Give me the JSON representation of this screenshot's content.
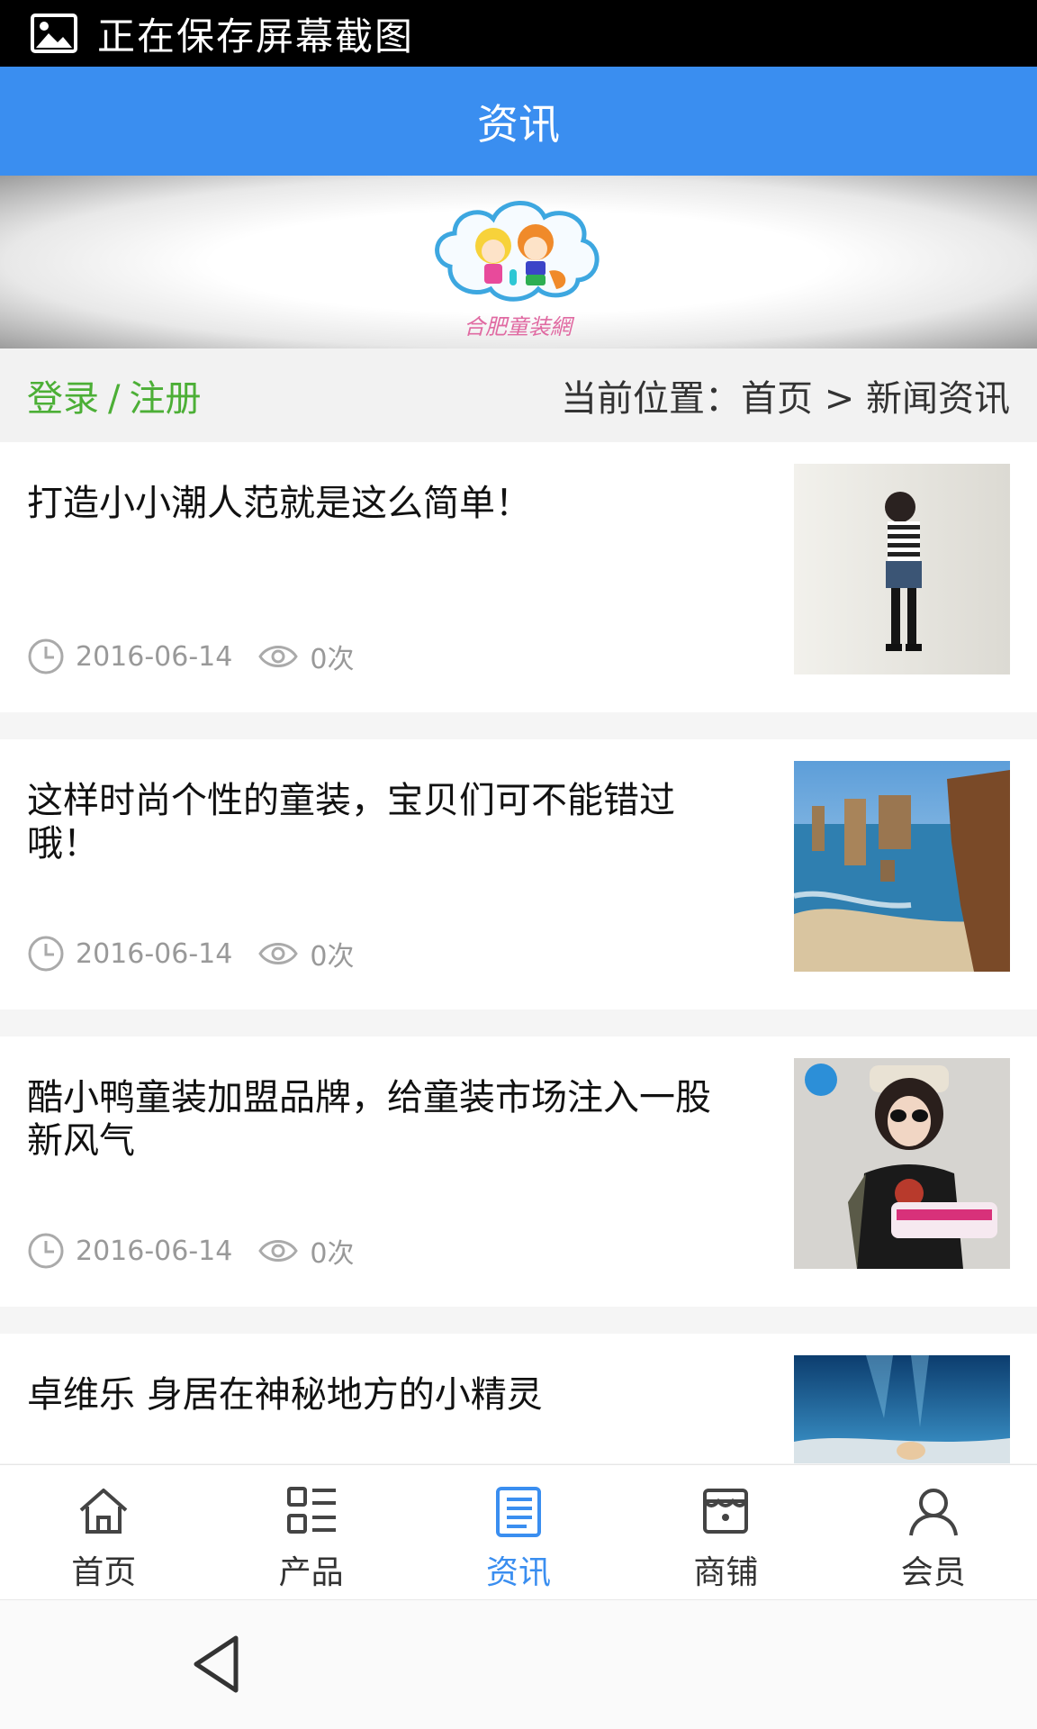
{
  "status_bar": {
    "text": "正在保存屏幕截图"
  },
  "header": {
    "title": "资讯"
  },
  "banner": {
    "logo_text": "合肥童装網"
  },
  "info_bar": {
    "login": "登录",
    "separator": "/",
    "register": "注册",
    "breadcrumb": "当前位置：首页 > 新闻资讯"
  },
  "news": [
    {
      "title": "打造小小潮人范就是这么简单！",
      "date": "2016-06-14",
      "views": "0次"
    },
    {
      "title": "这样时尚个性的童装，宝贝们可不能错过哦！",
      "date": "2016-06-14",
      "views": "0次"
    },
    {
      "title": "酷小鸭童装加盟品牌，给童装市场注入一股新风气",
      "date": "2016-06-14",
      "views": "0次"
    },
    {
      "title": "卓维乐 身居在神秘地方的小精灵"
    }
  ],
  "tabbar": {
    "items": [
      {
        "label": "首页",
        "icon": "home-icon"
      },
      {
        "label": "产品",
        "icon": "grid-list-icon"
      },
      {
        "label": "资讯",
        "icon": "news-doc-icon",
        "active": true
      },
      {
        "label": "商铺",
        "icon": "store-icon"
      },
      {
        "label": "会员",
        "icon": "user-icon"
      }
    ]
  },
  "colors": {
    "header_bg": "#3a8ef0",
    "active_tab": "#3a8ef0",
    "auth_link": "#4caf36",
    "meta_text": "#999999"
  }
}
